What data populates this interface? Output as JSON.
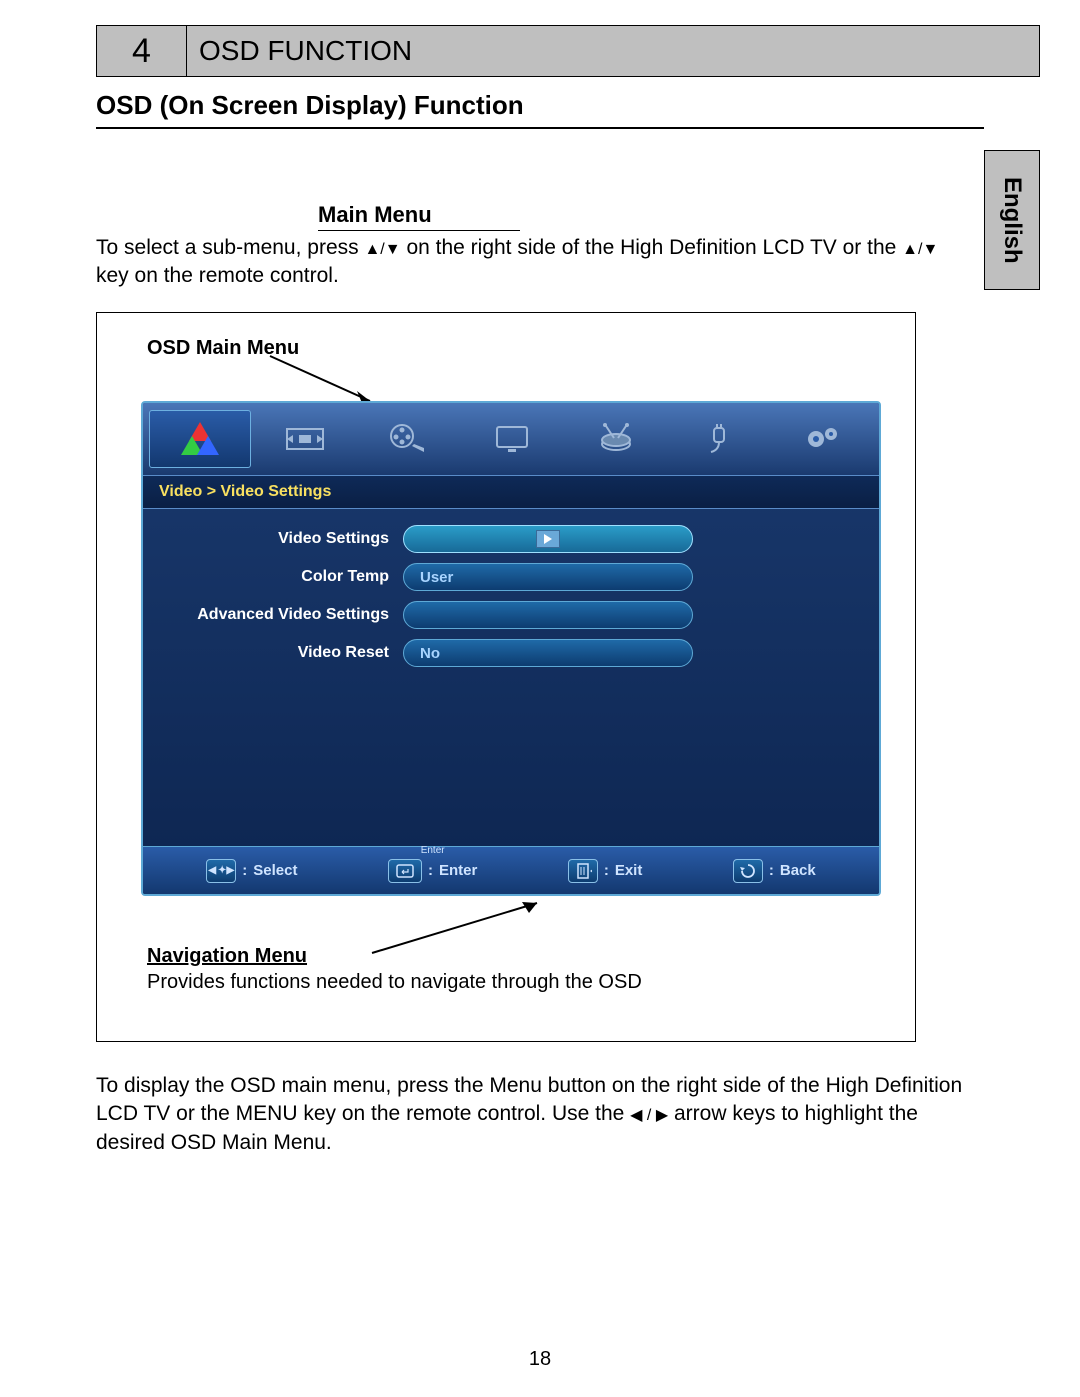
{
  "header": {
    "number": "4",
    "title": "OSD FUNCTION"
  },
  "section_title": "OSD (On Screen Display) Function",
  "language_tab": "English",
  "main_menu": {
    "heading": "Main Menu",
    "intro_a": "To select a sub-menu, press ",
    "intro_b": " on the right side of the High Definition LCD TV or the ",
    "intro_c": " key on the remote control."
  },
  "figure": {
    "osd_label": "OSD Main Menu",
    "breadcrumb": "Video > Video Settings",
    "items": [
      {
        "label": "Video Settings",
        "value": "",
        "has_play": true
      },
      {
        "label": "Color Temp",
        "value": "User",
        "has_play": false
      },
      {
        "label": "Advanced Video Settings",
        "value": "",
        "has_play": false
      },
      {
        "label": "Video Reset",
        "value": "No",
        "has_play": false
      }
    ],
    "nav": {
      "select": "Select",
      "enter_top": "Enter",
      "enter": "Enter",
      "exit": "Exit",
      "back": "Back"
    },
    "nav_label": "Navigation Menu",
    "nav_desc": "Provides functions needed to navigate through the OSD"
  },
  "bottom": {
    "a": "To display the OSD main menu, press the Menu button on the right side of the High Definition LCD TV or the MENU key on the remote control. Use the ",
    "b": " arrow keys to highlight the desired OSD Main Menu."
  },
  "page_number": "18",
  "icons": {
    "tab_video": "rgb-triangle-icon",
    "tab_pip": "pip-icon",
    "tab_movie": "film-reel-icon",
    "tab_screen": "screen-icon",
    "tab_audio": "drum-icon",
    "tab_input": "plug-icon",
    "tab_setup": "gears-icon"
  }
}
